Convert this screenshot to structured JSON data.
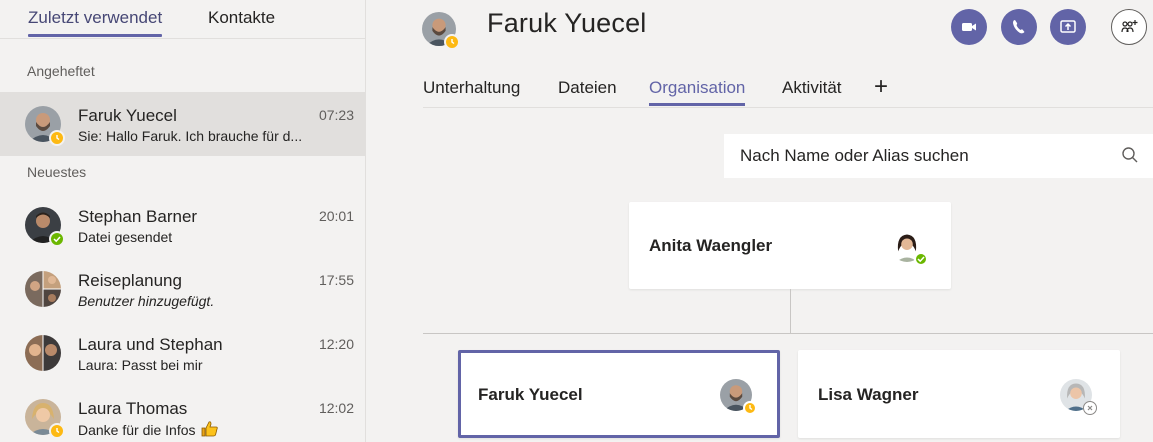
{
  "left_panel": {
    "tabs": [
      {
        "label": "Zuletzt verwendet",
        "active": true
      },
      {
        "label": "Kontakte",
        "active": false
      }
    ],
    "pinned_label": "Angeheftet",
    "recent_label": "Neuestes",
    "pinned_chats": [
      {
        "name": "Faruk Yuecel",
        "time": "07:23",
        "preview": "Sie: Hallo Faruk. Ich brauche für d...",
        "presence": "away",
        "avatar": "bearded-man-avatar"
      }
    ],
    "recent_chats": [
      {
        "name": "Stephan Barner",
        "time": "20:01",
        "preview": "Datei gesendet",
        "presence": "available",
        "avatar": "man-avatar"
      },
      {
        "name": "Reiseplanung",
        "time": "17:55",
        "preview": "Benutzer hinzugefügt.",
        "presence": "",
        "avatar": "group-avatar"
      },
      {
        "name": "Laura und Stephan",
        "time": "12:20",
        "preview": "Laura: Passt bei mir",
        "presence": "",
        "avatar": "pair-avatar"
      },
      {
        "name": "Laura Thomas",
        "time": "12:02",
        "preview": "Danke für die Infos",
        "presence": "away",
        "avatar": "woman-avatar"
      }
    ]
  },
  "header": {
    "title": "Faruk Yuecel",
    "presence": "away",
    "buttons": [
      "video-call-icon",
      "audio-call-icon",
      "share-screen-icon",
      "add-people-icon"
    ]
  },
  "tabs": [
    {
      "label": "Unterhaltung",
      "active": false
    },
    {
      "label": "Dateien",
      "active": false
    },
    {
      "label": "Organisation",
      "active": true
    },
    {
      "label": "Aktivität",
      "active": false
    }
  ],
  "add_tab_symbol": "+",
  "search": {
    "placeholder": "Nach Name oder Alias suchen"
  },
  "org": {
    "manager": {
      "name": "Anita Waengler",
      "presence": "available"
    },
    "peers": [
      {
        "name": "Faruk Yuecel",
        "presence": "away",
        "selected": true
      },
      {
        "name": "Lisa Wagner",
        "presence": "offline",
        "selected": false
      }
    ]
  },
  "colors": {
    "accent": "#6264a7",
    "away": "#fdb913",
    "available": "#6bb700"
  },
  "emoji": "thumbs-up-icon"
}
